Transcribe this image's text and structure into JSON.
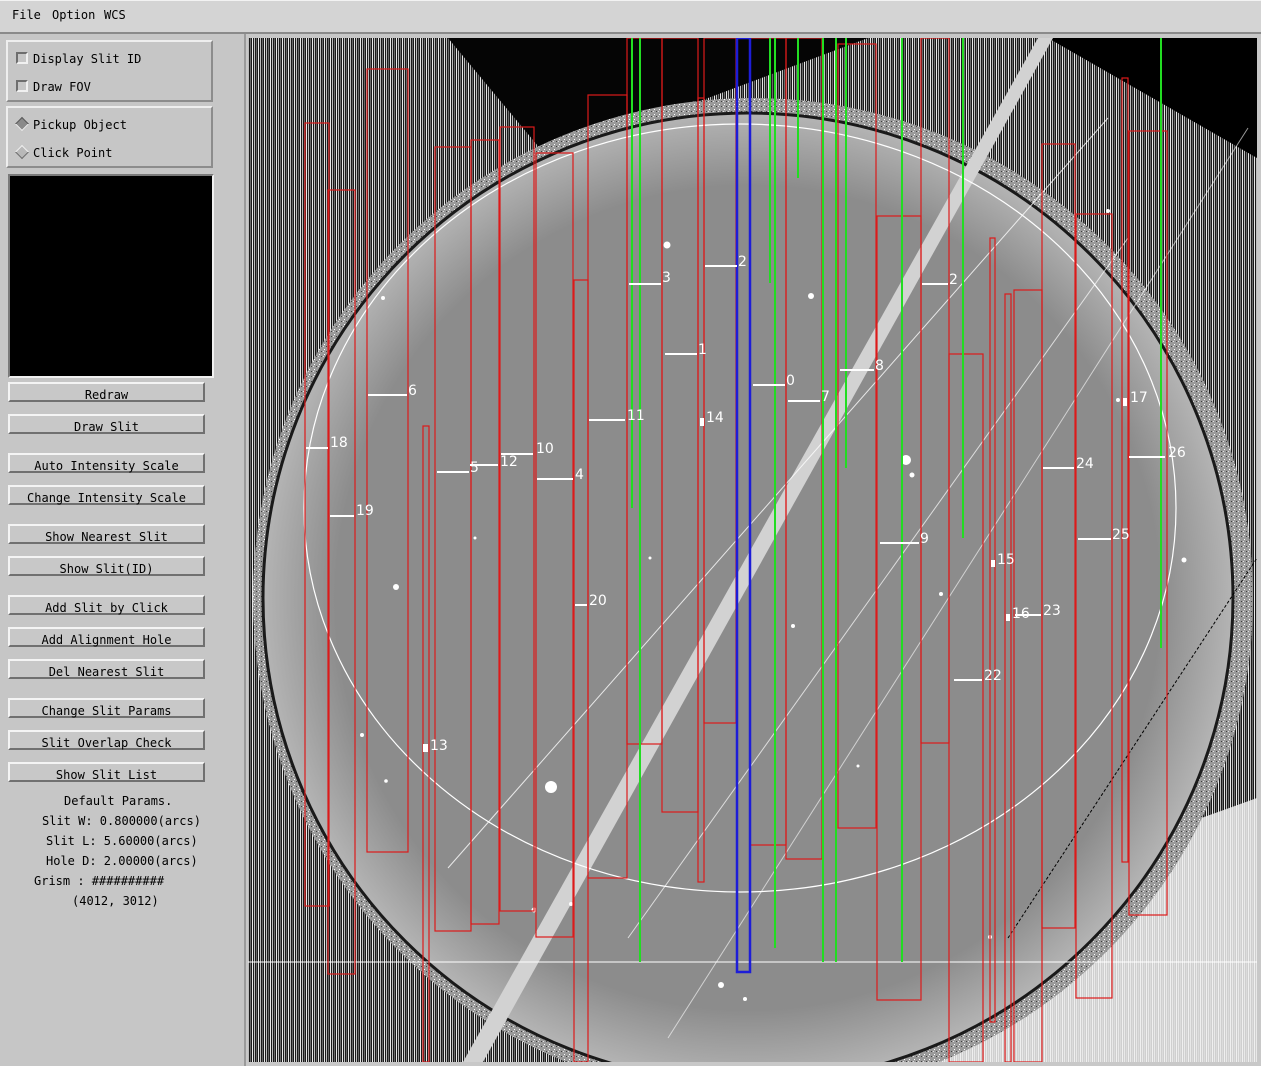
{
  "menubar": {
    "file": "File",
    "option": "Option",
    "wcs": "WCS"
  },
  "display_options": {
    "display_slit_id": "Display Slit ID",
    "draw_fov": "Draw FOV"
  },
  "click_mode": {
    "pickup_object": "Pickup Object",
    "click_point": "Click Point",
    "selected": "Pickup Object"
  },
  "buttons": {
    "redraw": "Redraw",
    "draw_slit": "Draw Slit",
    "auto_intensity": "Auto Intensity Scale",
    "change_intensity": "Change Intensity Scale",
    "show_nearest": "Show Nearest Slit",
    "show_slit_id": "Show Slit(ID)",
    "add_slit": "Add Slit by Click",
    "add_alignment": "Add Alignment Hole",
    "del_nearest": "Del Nearest Slit",
    "change_params": "Change Slit Params",
    "overlap_check": "Slit Overlap Check",
    "show_list": "Show Slit List"
  },
  "params": {
    "heading": "Default Params.",
    "slit_w": "Slit W: 0.800000(arcs)",
    "slit_l": "Slit L: 5.60000(arcs)",
    "hole_d": "Hole D: 2.00000(arcs)",
    "grism": "Grism : ##########",
    "cursor": "(4012, 3012)"
  },
  "colors": {
    "slit_box": "#dd1a1a",
    "slit_mark": "#ffffff",
    "spectrum": "#22dd22",
    "selected_slit": "#1d1dd8",
    "fov_circle": "#ffffff"
  },
  "slit_labels": [
    "0",
    "1",
    "2",
    "3",
    "4",
    "5",
    "6",
    "7",
    "8",
    "9",
    "10",
    "11",
    "12",
    "13",
    "14",
    "15",
    "16",
    "17",
    "18",
    "19",
    "20",
    "2",
    "22",
    "23",
    "24",
    "25",
    "26"
  ]
}
